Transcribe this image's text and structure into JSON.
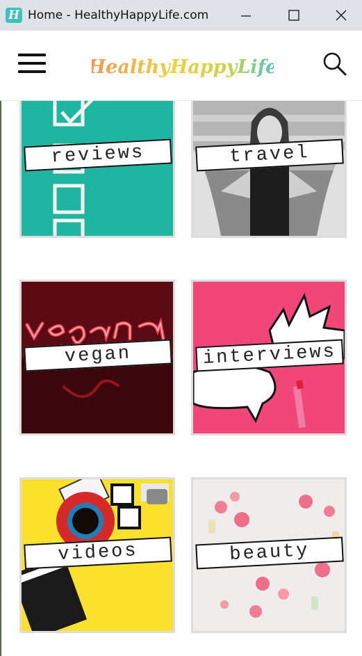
{
  "window": {
    "icon_letter": "H",
    "title": "Home - HealthyHappyLife.com"
  },
  "header": {
    "logo_text": "HealthyHappyLife",
    "menu_icon": "hamburger-menu-icon",
    "search_icon": "search-icon"
  },
  "categories": [
    {
      "label": "reviews"
    },
    {
      "label": "travel"
    },
    {
      "label": "vegan"
    },
    {
      "label": "interviews"
    },
    {
      "label": "videos"
    },
    {
      "label": "beauty"
    }
  ],
  "colors": {
    "titlebar": "#dfe3e8",
    "teal": "#1fb5a3",
    "pink": "#f0467a",
    "yellow": "#fbe12b",
    "neon_red": "#e8202e",
    "logo_orange": "#f19559",
    "logo_yellow": "#f3cf3c",
    "logo_teal": "#47c6c4"
  }
}
